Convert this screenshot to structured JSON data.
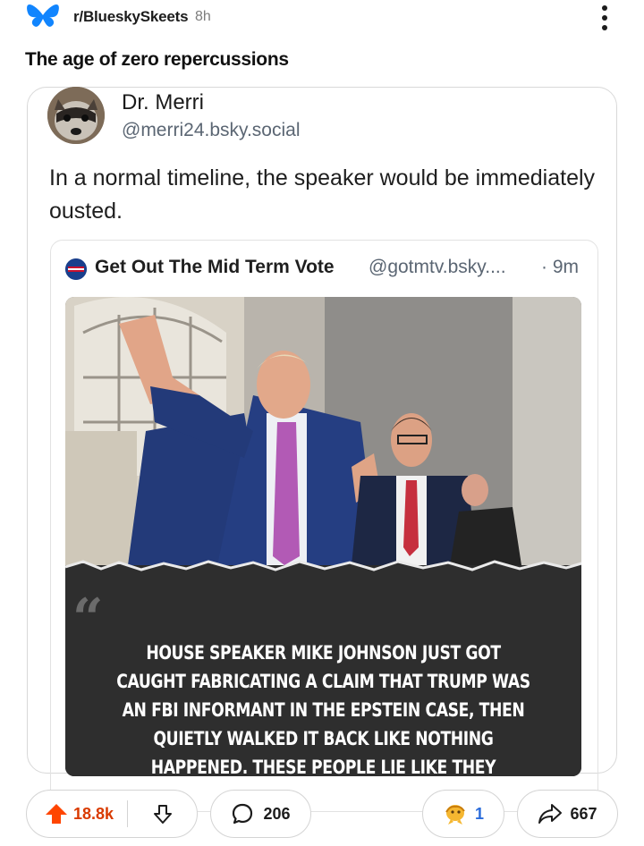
{
  "header": {
    "subreddit": "r/BlueskySkeets",
    "age": "8h",
    "icon": "butterfly-icon",
    "menu_icon": "kebab-menu-icon"
  },
  "post": {
    "title": "The age of zero repercussions"
  },
  "embed": {
    "author_name": "Dr. Merri",
    "author_handle": "@merri24.bsky.social",
    "text": "In a normal timeline, the speaker would be immediately ousted.",
    "quote": {
      "author_name": "Get Out The Mid Term Vote",
      "author_handle": "@gotmtv.bsky....",
      "time": "· 9m",
      "image_caption": "HOUSE SPEAKER MIKE JOHNSON JUST GOT CAUGHT FABRICATING A CLAIM THAT TRUMP WAS AN FBI INFORMANT IN THE EPSTEIN CASE, THEN QUIETLY WALKED IT BACK LIKE NOTHING HAPPENED. THESE PEOPLE LIE LIKE THEY BREATHE."
    }
  },
  "actions": {
    "upvotes": "18.8k",
    "comments": "206",
    "awards": "1",
    "shares": "667"
  },
  "colors": {
    "upvote": "#ff4500",
    "vote_text": "#d93a00",
    "bluesky": "#1185fe"
  }
}
